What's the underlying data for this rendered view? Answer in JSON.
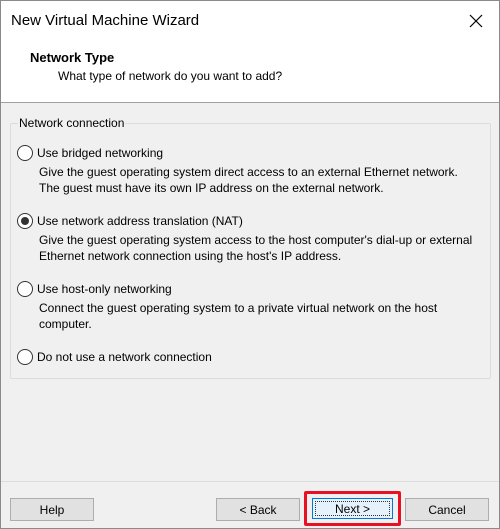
{
  "window": {
    "title": "New Virtual Machine Wizard"
  },
  "header": {
    "title": "Network Type",
    "subtitle": "What type of network do you want to add?"
  },
  "group": {
    "legend": "Network connection",
    "options": [
      {
        "label": "Use bridged networking",
        "description": "Give the guest operating system direct access to an external Ethernet network. The guest must have its own IP address on the external network.",
        "selected": false
      },
      {
        "label": "Use network address translation (NAT)",
        "description": "Give the guest operating system access to the host computer's dial-up or external Ethernet network connection using the host's IP address.",
        "selected": true
      },
      {
        "label": "Use host-only networking",
        "description": "Connect the guest operating system to a private virtual network on the host computer.",
        "selected": false
      },
      {
        "label": "Do not use a network connection",
        "description": "",
        "selected": false
      }
    ]
  },
  "buttons": {
    "help": "Help",
    "back": "< Back",
    "next": "Next >",
    "cancel": "Cancel"
  },
  "icons": {
    "close": "close-icon"
  },
  "colors": {
    "highlight": "#e81123",
    "focus": "#0078d7"
  }
}
